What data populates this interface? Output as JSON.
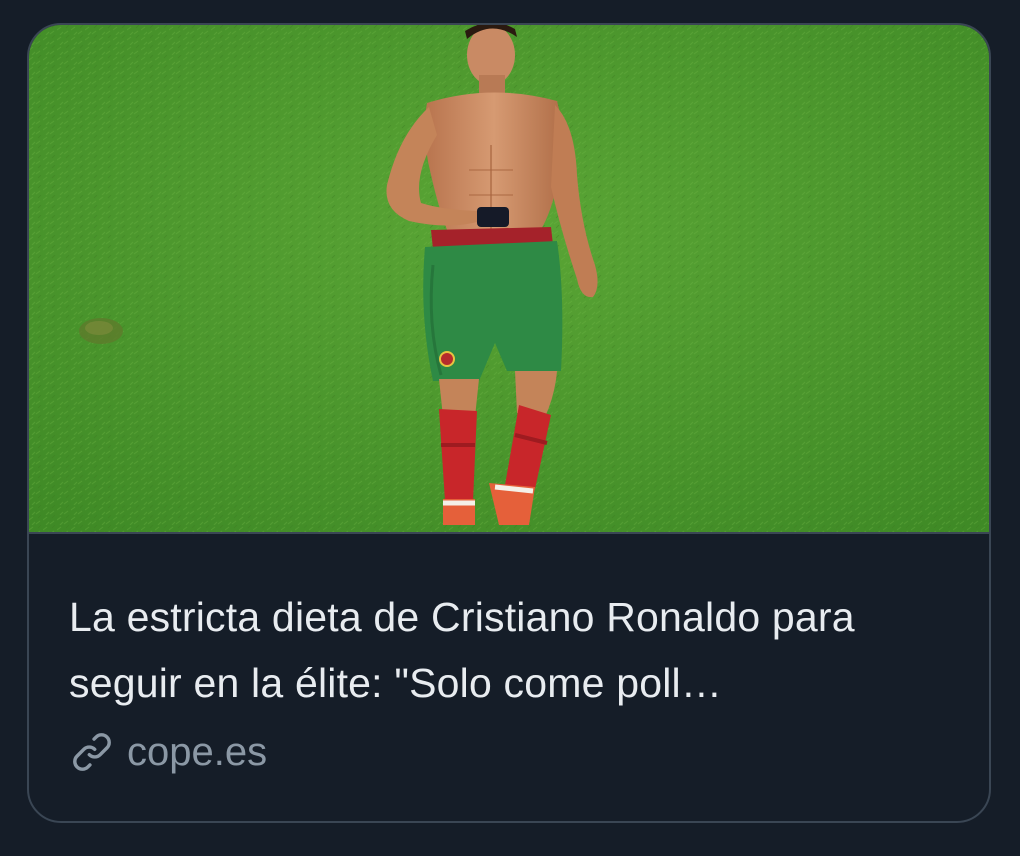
{
  "card": {
    "headline": "La estricta dieta de Cristiano Ronaldo para seguir en la élite: \"Solo come poll…",
    "source": "cope.es",
    "source_icon": "link-icon",
    "image": {
      "subject": "shirtless soccer player in green shorts and red socks walking on grass pitch",
      "colors": {
        "grass": "#4e9a2e",
        "shorts": "#2e8a45",
        "socks": "#c8262a",
        "skin": "#c98a64"
      }
    }
  },
  "colors": {
    "background": "#151d28",
    "border": "#3a4654",
    "headline_text": "#e8ecf0",
    "muted_text": "#8b98a5"
  }
}
